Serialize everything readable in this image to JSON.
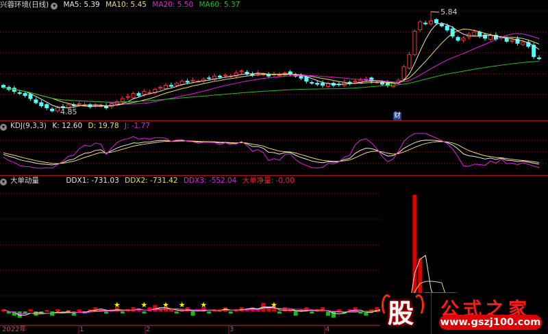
{
  "main_header": {
    "stock_name": "兴蓉环境(日线)",
    "ma5": "MA5: 5.39",
    "ma10": "MA10: 5.45",
    "ma20": "MA20: 5.50",
    "ma60": "MA60: 5.37"
  },
  "kdj_header": {
    "title": "KDJ(9,3,3)",
    "k": "K: 12.60",
    "d": "D: 19.78",
    "j": "J: -1.77"
  },
  "ddx_header": {
    "title": "大单动量",
    "ddx1": "DDX1: -731.03",
    "ddx2": "DDX2: -731.42",
    "ddx3": "DDX3: -552.04",
    "net": "大单净量: -0.00"
  },
  "markers": {
    "high_label": "5.84",
    "low_label": "4.85",
    "finance_marker": "财"
  },
  "date_axis": [
    "2022年",
    "1",
    "2",
    "3",
    "4"
  ],
  "watermark": {
    "logo_char": "股",
    "site_name": "公式之家",
    "url": "www.gszj100.com"
  },
  "colors": {
    "up": "#ff3232",
    "down": "#54fcfc",
    "ma5": "#e8e8e8",
    "ma10": "#e8e070",
    "ma20": "#e020e0",
    "ma60": "#20c020",
    "grid": "#8b1a1a"
  },
  "chart_data": [
    {
      "type": "candlestick",
      "title": "兴蓉环境(日线)",
      "ylim": [
        4.85,
        5.84
      ],
      "high": 5.84,
      "low": 4.85,
      "close": [
        5.1,
        5.08,
        5.06,
        5.04,
        5.02,
        4.99,
        4.95,
        4.92,
        4.9,
        4.87,
        4.9,
        4.91,
        4.93,
        4.92,
        4.94,
        4.93,
        4.91,
        4.93,
        4.92,
        4.9,
        4.94,
        4.96,
        4.99,
        5.01,
        5.04,
        5.02,
        5.06,
        5.05,
        5.08,
        5.1,
        5.12,
        5.11,
        5.14,
        5.16,
        5.15,
        5.17,
        5.16,
        5.18,
        5.19,
        5.21,
        5.2,
        5.22,
        5.21,
        5.24,
        5.26,
        5.23,
        5.22,
        5.24,
        5.23,
        5.21,
        5.23,
        5.22,
        5.24,
        5.23,
        5.21,
        5.19,
        5.16,
        5.14,
        5.13,
        5.12,
        5.14,
        5.12,
        5.13,
        5.15,
        5.14,
        5.16,
        5.17,
        5.18,
        5.16,
        5.15,
        5.13,
        5.12,
        5.14,
        5.17,
        5.3,
        5.42,
        5.65,
        5.74,
        5.72,
        5.75,
        5.73,
        5.7,
        5.66,
        5.6,
        5.56,
        5.58,
        5.62,
        5.64,
        5.6,
        5.58,
        5.61,
        5.57,
        5.59,
        5.55,
        5.56,
        5.53,
        5.54,
        5.5,
        5.4,
        5.38
      ],
      "ma_periods": [
        5,
        10,
        20,
        60
      ]
    },
    {
      "type": "line",
      "title": "KDJ(9,3,3)",
      "series": [
        "K",
        "D",
        "J"
      ],
      "ylim": [
        -10,
        110
      ]
    },
    {
      "type": "bar",
      "title": "大单动量",
      "ddx": [
        1,
        -1,
        -2,
        -3,
        -1,
        1,
        -2,
        -1,
        0,
        -2,
        1,
        -1,
        0,
        -2,
        1,
        -1,
        1,
        2,
        1,
        -1,
        1,
        2,
        -1,
        1,
        2,
        1,
        -1,
        2,
        3,
        1,
        2,
        1,
        -1,
        1,
        2,
        -2,
        1,
        2,
        -1,
        1,
        1,
        2,
        -1,
        1,
        2,
        1,
        2,
        1,
        4,
        2,
        1,
        -1,
        2,
        1,
        -2,
        1,
        2,
        -1,
        1,
        2,
        -2,
        -3,
        1,
        -1,
        1,
        2,
        -1,
        -2,
        1,
        2,
        1,
        -1,
        2,
        1,
        3,
        2,
        55,
        25,
        8,
        2,
        1,
        -1,
        1,
        2,
        1,
        -2,
        -1,
        1,
        2,
        1,
        -1,
        1,
        2,
        1,
        -1,
        1,
        2,
        -1,
        1,
        -2
      ],
      "star_indices": [
        21,
        26,
        30,
        33,
        37,
        50
      ]
    }
  ]
}
